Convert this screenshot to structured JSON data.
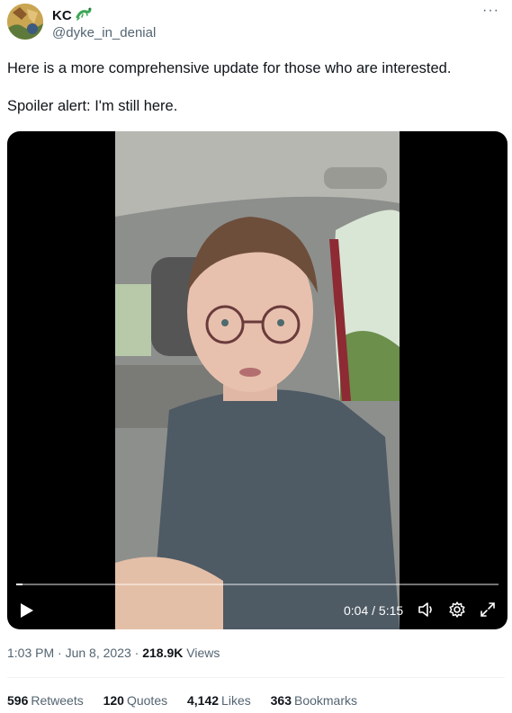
{
  "author": {
    "display_name": "KC",
    "handle": "@dyke_in_denial",
    "badge_icon": "lizard-emoji-icon",
    "avatar_icon": "avatar-image"
  },
  "more_icon": "more-options-icon",
  "tweet": {
    "line1": "Here is a more comprehensive update for those who are interested.",
    "line2": "Spoiler alert: I'm still here."
  },
  "video": {
    "current_time": "0:04",
    "duration": "5:15",
    "time_display": "0:04 / 5:15",
    "progress_fraction": 0.013,
    "controls": [
      "play-icon",
      "volume-icon",
      "settings-gear-icon",
      "fullscreen-icon"
    ]
  },
  "meta": {
    "time": "1:03 PM",
    "date": "Jun 8, 2023",
    "views_count": "218.9K",
    "views_label": "Views"
  },
  "stats": {
    "retweets_count": "596",
    "retweets_label": "Retweets",
    "quotes_count": "120",
    "quotes_label": "Quotes",
    "likes_count": "4,142",
    "likes_label": "Likes",
    "bookmarks_count": "363",
    "bookmarks_label": "Bookmarks"
  },
  "colors": {
    "text_primary": "#0f1419",
    "text_secondary": "#536471",
    "divider": "#eff3f4",
    "video_bg": "#000000"
  }
}
